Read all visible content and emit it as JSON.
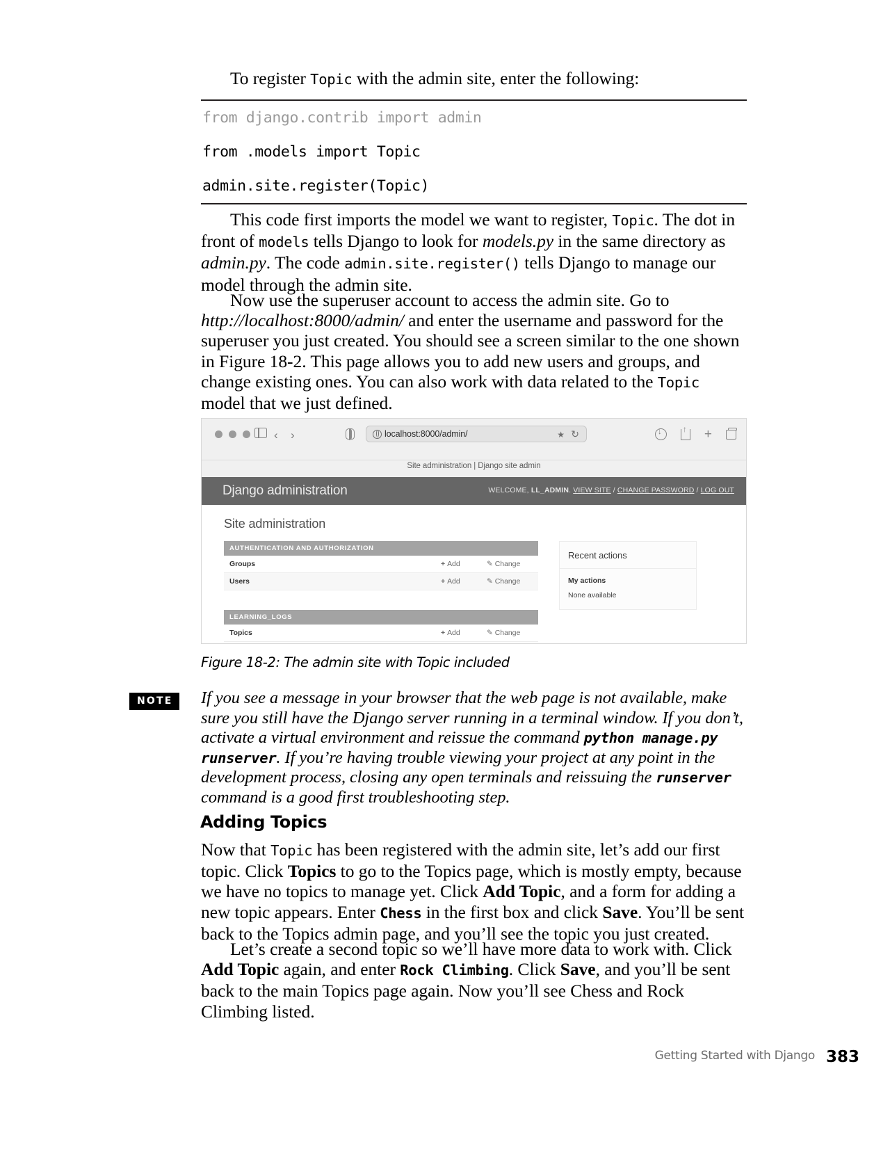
{
  "intro": {
    "lead_pre": "To register ",
    "lead_code": "Topic",
    "lead_post": " with the admin site, enter the following:"
  },
  "code_block": {
    "line1": "from django.contrib import admin",
    "line2": "from .models import Topic",
    "line3": "admin.site.register(Topic)"
  },
  "paragraphs": {
    "p1": {
      "t1": "This code first imports the model we want to register, ",
      "c1": "Topic",
      "t2": ". The dot in front of ",
      "c2": "models",
      "t3": " tells Django to look for ",
      "i1": "models.py",
      "t4": " in the same directory as ",
      "i2": "admin.py",
      "t5": ". The code ",
      "c3": "admin.site.register()",
      "t6": " tells Django to manage our model through the admin site."
    },
    "p2": {
      "t1": "Now use the superuser account to access the admin site. Go to ",
      "i1": "http://localhost:8000/admin/",
      "t2": " and enter the username and password for the superuser you just created. You should see a screen similar to the one shown in Figure 18-2. This page allows you to add new users and groups, and change existing ones. You can also work with data related to the ",
      "c1": "Topic",
      "t3": " model that we just defined."
    }
  },
  "figure": {
    "browser": {
      "url": "localhost:8000/admin/",
      "page_title": "Site administration | Django site admin",
      "traffic_lights": [
        "close-dot",
        "minimize-dot",
        "zoom-dot"
      ],
      "icons": {
        "sidebar": "sidebar-toggle-icon",
        "back": "‹",
        "forward": "›",
        "shield": "reader-mode-icon",
        "globe": "site-info-icon",
        "extensions": "extensions-icon",
        "reload": "↻",
        "download": "download-icon",
        "share": "share-icon",
        "new_tab": "+",
        "tabs_overview": "tab-overview-icon"
      }
    },
    "admin": {
      "brand": "Django administration",
      "welcome_prefix": "WELCOME, ",
      "username": "LL_ADMIN",
      "welcome_sep": ". ",
      "links": [
        "VIEW SITE",
        "CHANGE PASSWORD",
        "LOG OUT"
      ],
      "heading": "Site administration",
      "apps": [
        {
          "name": "AUTHENTICATION AND AUTHORIZATION",
          "models": [
            {
              "label": "Groups",
              "add": "Add",
              "change": "Change"
            },
            {
              "label": "Users",
              "add": "Add",
              "change": "Change"
            }
          ]
        },
        {
          "name": "LEARNING_LOGS",
          "models": [
            {
              "label": "Topics",
              "add": "Add",
              "change": "Change"
            }
          ]
        }
      ],
      "sidebar": {
        "title": "Recent actions",
        "subtitle": "My actions",
        "empty": "None available"
      }
    },
    "caption": "Figure 18-2: The admin site with Topic included"
  },
  "note": {
    "badge": "NOTE",
    "t1": "If you see a message in your browser that the web page is not available, make sure you still have the Django server running in a terminal window. If you don’t, activate a virtual environment and reissue the command ",
    "c1": "python manage.py runserver",
    "t2": ". If you’re having trouble viewing your project at any point in the development process, closing any open terminals and reissuing the ",
    "c2": "runserver",
    "t3": " command is a good first troubleshooting step."
  },
  "section": {
    "heading": "Adding Topics",
    "p1": {
      "t1": "Now that ",
      "c1": "Topic",
      "t2": " has been registered with the admin site, let’s add our first topic. Click ",
      "b1": "Topics",
      "t3": " to go to the Topics page, which is mostly empty, because we have no topics to manage yet. Click ",
      "b2": "Add Topic",
      "t4": ", and a form for adding a new topic appears. Enter ",
      "c2": "Chess",
      "t5": " in the first box and click ",
      "b3": "Save",
      "t6": ". You’ll be sent back to the Topics admin page, and you’ll see the topic you just created."
    },
    "p2": {
      "t1": "Let’s create a second topic so we’ll have more data to work with. Click ",
      "b1": "Add Topic",
      "t2": " again, and enter ",
      "c1": "Rock Climbing",
      "t3": ". Click ",
      "b2": "Save",
      "t4": ", and you’ll be sent back to the main Topics page again. Now you’ll see Chess and Rock Climbing listed."
    }
  },
  "footer": {
    "chapter": "Getting Started with Django",
    "page_number": "383"
  }
}
